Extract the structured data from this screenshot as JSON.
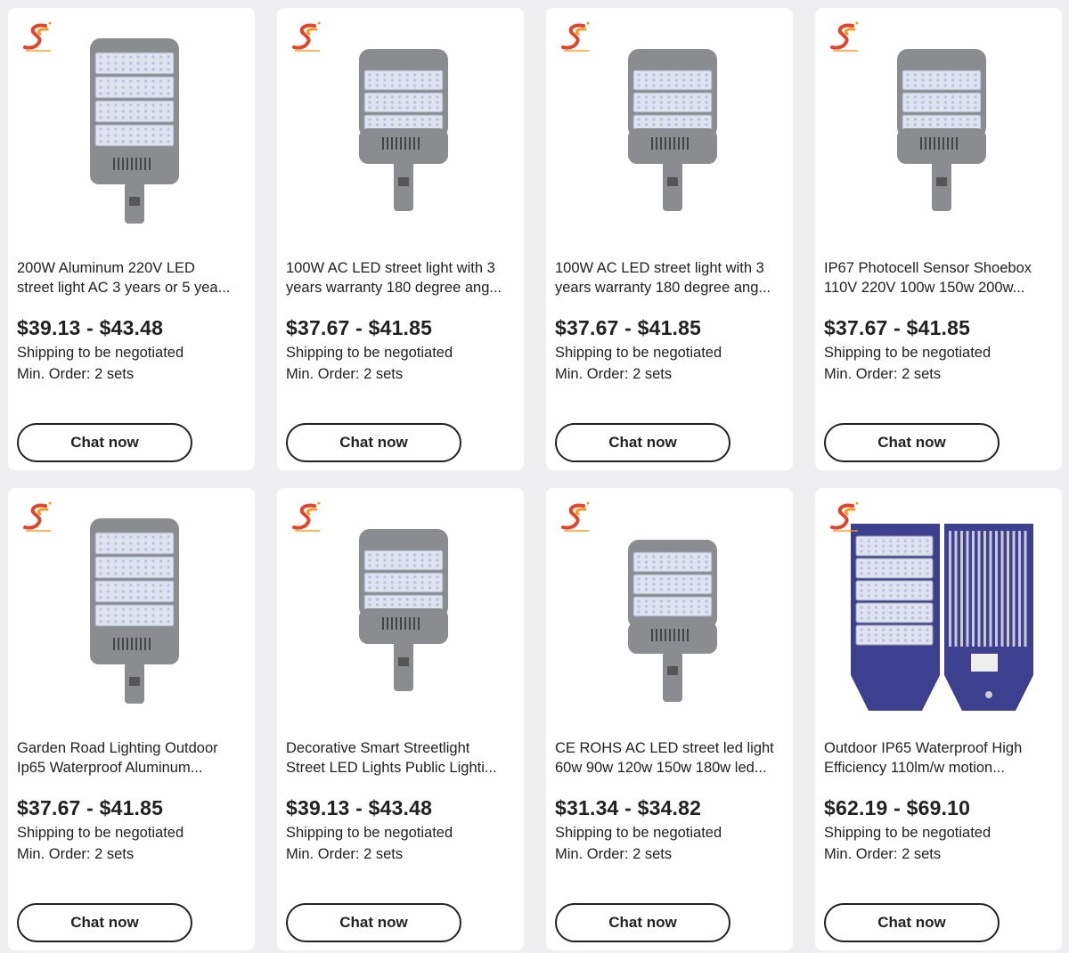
{
  "brand": {
    "logo_text": "SUNXIJIAN",
    "logo_icon": "brand-s-logo-icon"
  },
  "products": [
    {
      "title_line1": "200W Aluminum 220V LED",
      "title_line2": "street light AC 3 years or 5 yea...",
      "price": "$39.13 - $43.48",
      "shipping": "Shipping to be negotiated",
      "min_order": "Min. Order: 2 sets",
      "cta": "Chat now",
      "image": "tall-4-module-street-light"
    },
    {
      "title_line1": "100W AC LED street light with 3",
      "title_line2": "years warranty 180 degree ang...",
      "price": "$37.67 - $41.85",
      "shipping": "Shipping to be negotiated",
      "min_order": "Min. Order: 2 sets",
      "cta": "Chat now",
      "image": "2-module-street-light"
    },
    {
      "title_line1": "100W AC LED street light with 3",
      "title_line2": "years warranty 180 degree ang...",
      "price": "$37.67 - $41.85",
      "shipping": "Shipping to be negotiated",
      "min_order": "Min. Order: 2 sets",
      "cta": "Chat now",
      "image": "2-module-street-light"
    },
    {
      "title_line1": "IP67 Photocell Sensor Shoebox",
      "title_line2": "110V 220V 100w 150w 200w...",
      "price": "$37.67 - $41.85",
      "shipping": "Shipping to be negotiated",
      "min_order": "Min. Order: 2 sets",
      "cta": "Chat now",
      "image": "2-module-street-light"
    },
    {
      "title_line1": "Garden Road Lighting Outdoor",
      "title_line2": "Ip65 Waterproof Aluminum...",
      "price": "$37.67 - $41.85",
      "shipping": "Shipping to be negotiated",
      "min_order": "Min. Order: 2 sets",
      "cta": "Chat now",
      "image": "tall-4-module-street-light"
    },
    {
      "title_line1": "Decorative Smart Streetlight",
      "title_line2": "Street LED Lights Public Lighti...",
      "price": "$39.13 - $43.48",
      "shipping": "Shipping to be negotiated",
      "min_order": "Min. Order: 2 sets",
      "cta": "Chat now",
      "image": "2-module-street-light"
    },
    {
      "title_line1": "CE ROHS AC LED street led light",
      "title_line2": "60w 90w 120w 150w 180w led...",
      "price": "$31.34 - $34.82",
      "shipping": "Shipping to be negotiated",
      "min_order": "Min. Order: 2 sets",
      "cta": "Chat now",
      "image": "3-module-street-light"
    },
    {
      "title_line1": "Outdoor IP65 Waterproof High",
      "title_line2": "Efficiency 110lm/w motion...",
      "price": "$62.19 - $69.10",
      "shipping": "Shipping to be negotiated",
      "min_order": "Min. Order: 2 sets",
      "cta": "Chat now",
      "image": "blue-front-and-back-street-light"
    }
  ],
  "colors": {
    "page_bg": "#efeff1",
    "card_bg": "#ffffff",
    "text": "#222222",
    "logo_orange": "#f39a1e",
    "logo_red": "#e0452a",
    "lamp_grey": "#8a8c90",
    "lamp_blue": "#3d3f8f"
  }
}
